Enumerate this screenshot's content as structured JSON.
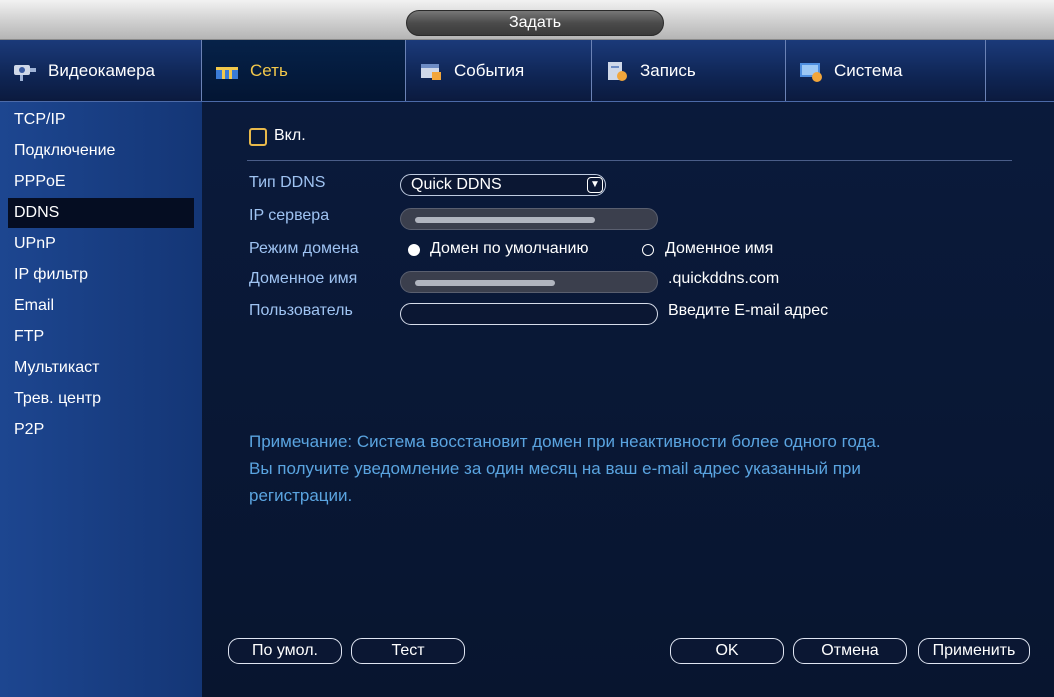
{
  "window": {
    "title": "Задать"
  },
  "tabs": [
    {
      "label": "Видеокамера",
      "icon": "camera-icon"
    },
    {
      "label": "Сеть",
      "icon": "network-icon"
    },
    {
      "label": "События",
      "icon": "events-icon"
    },
    {
      "label": "Запись",
      "icon": "record-icon"
    },
    {
      "label": "Система",
      "icon": "system-icon"
    }
  ],
  "sidebar": {
    "items": [
      {
        "label": "TCP/IP"
      },
      {
        "label": "Подключение"
      },
      {
        "label": "PPPoE"
      },
      {
        "label": "DDNS"
      },
      {
        "label": "UPnP"
      },
      {
        "label": "IP фильтр"
      },
      {
        "label": "Email"
      },
      {
        "label": "FTP"
      },
      {
        "label": "Мультикаст"
      },
      {
        "label": "Трев. центр"
      },
      {
        "label": "P2P"
      }
    ],
    "active": "DDNS"
  },
  "form": {
    "enable_label": "Вкл.",
    "enable_checked": false,
    "ddns_type_label": "Тип DDNS",
    "ddns_type_value": "Quick DDNS",
    "server_ip_label": "IP сервера",
    "domain_mode_label": "Режим домена",
    "domain_mode_default": "Домен по умолчанию",
    "domain_mode_custom": "Доменное имя",
    "domain_mode_selected": "default",
    "domain_name_label": "Доменное имя",
    "domain_suffix": ".quickddns.com",
    "user_label": "Пользователь",
    "user_value": "",
    "user_hint": "Введите E-mail адрес"
  },
  "note": {
    "line1": "Примечание: Система восстановит домен при неактивности более одного года.",
    "line2": "Вы получите уведомление за один месяц на ваш e-mail адрес указанный при",
    "line3": "регистрации."
  },
  "buttons": {
    "default": "По умол.",
    "test": "Тест",
    "ok": "OK",
    "cancel": "Отмена",
    "apply": "Применить"
  },
  "colors": {
    "accent_tab": "#f2c84b",
    "label_blue": "#9fc3f2",
    "note_blue": "#5aa4e0",
    "checkbox_border": "#e8b94b"
  }
}
